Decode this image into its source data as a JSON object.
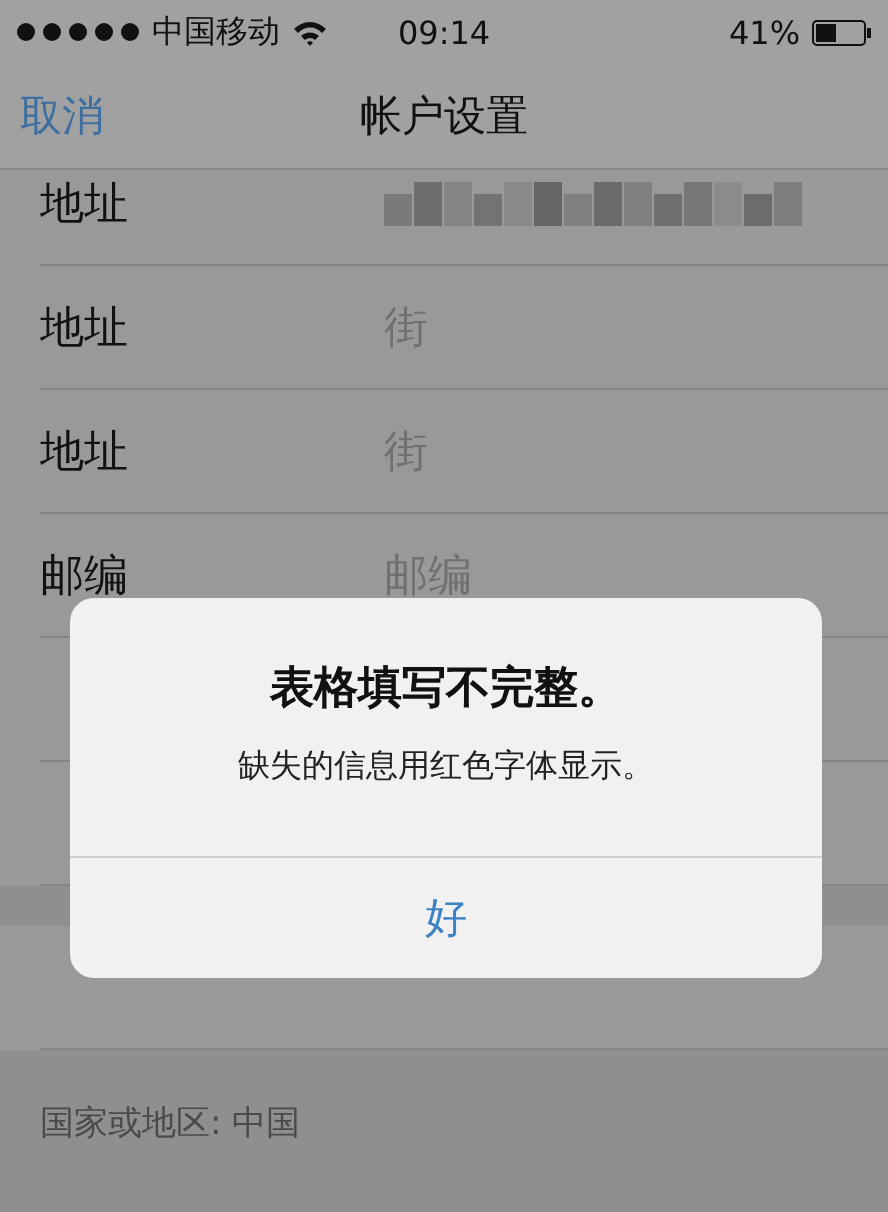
{
  "status_bar": {
    "carrier": "中国移动",
    "time": "09:14",
    "battery": "41%"
  },
  "nav": {
    "cancel": "取消",
    "title": "帐户设置"
  },
  "rows": [
    {
      "label": "地址",
      "kind": "redacted"
    },
    {
      "label": "地址",
      "kind": "field",
      "placeholder": "街"
    },
    {
      "label": "地址",
      "kind": "field",
      "placeholder": "街"
    },
    {
      "label": "邮编",
      "kind": "field",
      "placeholder": "邮编"
    },
    {
      "kind": "blank"
    },
    {
      "kind": "blank"
    },
    {
      "kind": "blank",
      "section_start": true
    }
  ],
  "footer": "国家或地区: 中国",
  "alert": {
    "title": "表格填写不完整。",
    "message": "缺失的信息用红色字体显示。",
    "button": "好"
  }
}
